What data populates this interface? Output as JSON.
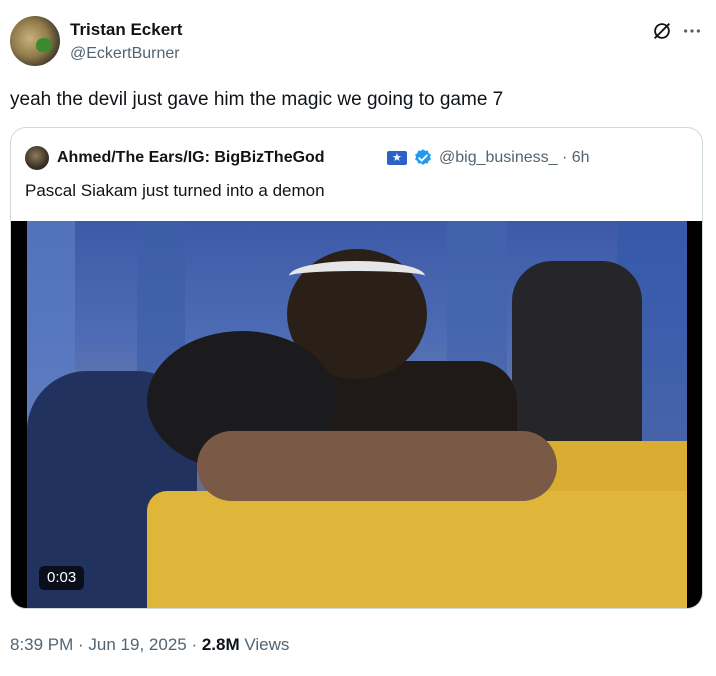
{
  "author": {
    "name": "Tristan Eckert",
    "handle": "@EckertBurner"
  },
  "tweet": {
    "text": "yeah the devil just gave him the magic we going to game 7"
  },
  "quoted": {
    "name": "Ahmed/The Ears/IG: BigBizTheGod",
    "handle_time": "@big_business_ · 6h",
    "text": "Pascal Siakam just turned into a demon",
    "video_time": "0:03"
  },
  "meta": {
    "time": "8:39 PM",
    "sep1": " · ",
    "date": "Jun 19, 2025",
    "sep2": " · ",
    "views_count": "2.8M",
    "views_label": " Views"
  },
  "colors": {
    "text_primary": "#0f1419",
    "text_secondary": "#536471",
    "verified_blue": "#1d9bf0",
    "border": "#cfd9de"
  },
  "icons": {
    "grok": "grok-icon",
    "more": "more-icon",
    "verified": "verified-badge-icon",
    "flag": "flag-icon"
  }
}
